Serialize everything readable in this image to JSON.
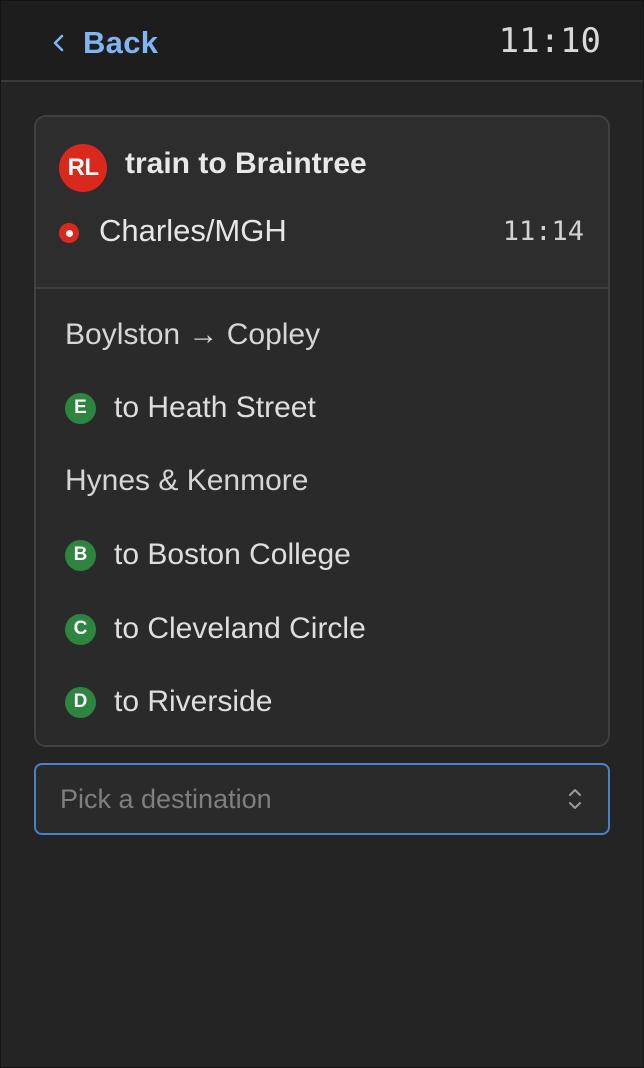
{
  "header": {
    "back_label": "Back",
    "clock": "11:10"
  },
  "trip": {
    "route_badge": "RL",
    "route_color": "#da291c",
    "title": "train to Braintree",
    "stop": {
      "name": "Charles/MGH",
      "time": "11:14"
    }
  },
  "connections": {
    "branch_color": "#2e8540",
    "items": [
      {
        "kind": "group",
        "label": "Boylston → Copley"
      },
      {
        "kind": "branch",
        "badge": "E",
        "label": "to Heath Street"
      },
      {
        "kind": "group",
        "label": "Hynes & Kenmore"
      },
      {
        "kind": "branch",
        "badge": "B",
        "label": "to Boston College"
      },
      {
        "kind": "branch",
        "badge": "C",
        "label": "to Cleveland Circle"
      },
      {
        "kind": "branch",
        "badge": "D",
        "label": "to Riverside"
      }
    ]
  },
  "destination": {
    "placeholder": "Pick a destination",
    "icon": "chevron-up-down-icon"
  },
  "icons": {
    "back": "chevron-left-icon"
  }
}
